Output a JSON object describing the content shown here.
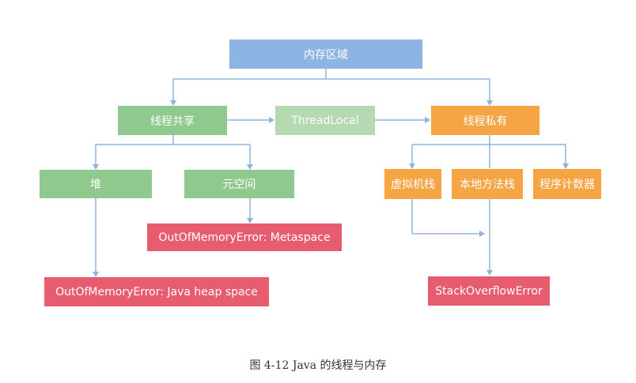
{
  "nodes": {
    "memory_area": "内存区域",
    "thread_shared": "线程共享",
    "thread_local": "ThreadLocal",
    "thread_private": "线程私有",
    "heap": "堆",
    "metaspace": "元空间",
    "oom_metaspace": "OutOfMemoryError: Metaspace",
    "oom_heap": "OutOfMemoryError: Java heap space",
    "vm_stack": "虚拟机栈",
    "native_stack": "本地方法栈",
    "pc_register": "程序计数器",
    "stack_overflow": "StackOverflowError"
  },
  "caption": "图 4-12 Java 的线程与内存",
  "colors": {
    "blue": "#8eb4e3",
    "green": "#8fc98d",
    "green_light": "#b5d9b0",
    "orange": "#f6a544",
    "red": "#e85c6f",
    "connector": "#8eb4e3"
  }
}
